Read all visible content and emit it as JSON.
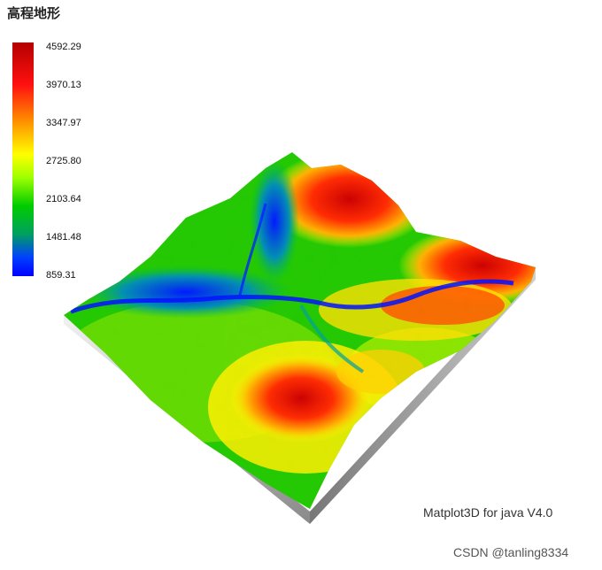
{
  "title": "高程地形",
  "chart_data": {
    "type": "heatmap",
    "title": "高程地形",
    "colorbar_ticks": [
      "4592.29",
      "3970.13",
      "3347.97",
      "2725.80",
      "2103.64",
      "1481.48",
      "859.31"
    ],
    "value_range": [
      859.31,
      4592.29
    ],
    "colormap": [
      "#0000ff",
      "#00a060",
      "#00cc00",
      "#9cff00",
      "#ffff00",
      "#ff8a00",
      "#ff1010",
      "#b40000"
    ]
  },
  "credit": "Matplot3D for java V4.0",
  "watermark": "CSDN @tanling8334"
}
